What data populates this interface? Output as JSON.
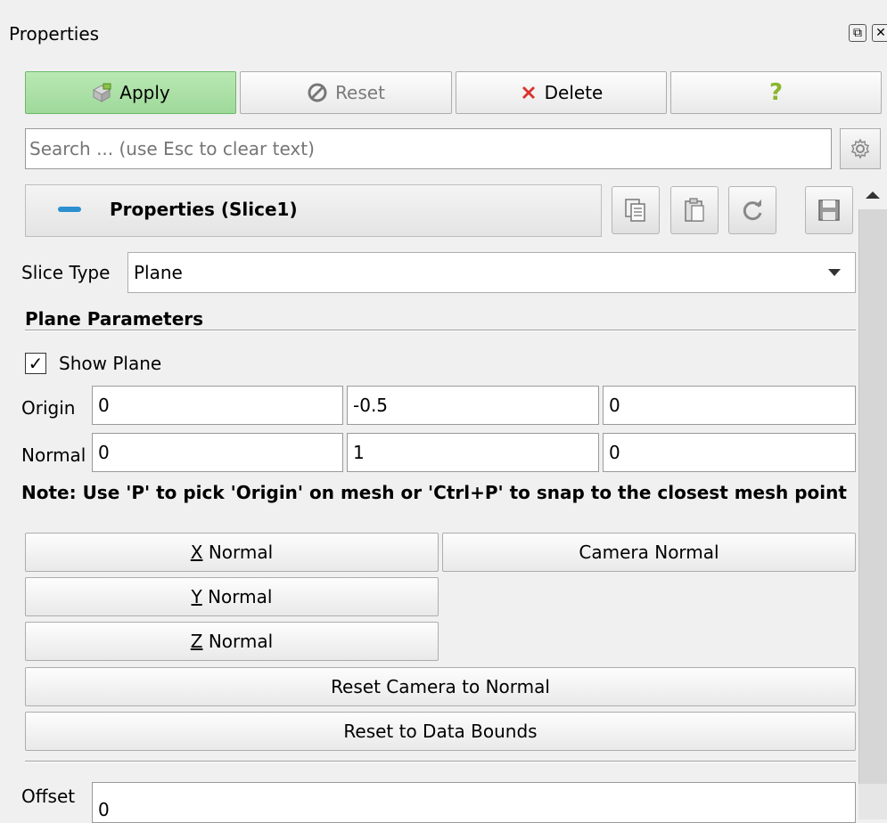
{
  "panel": {
    "title": "Properties",
    "float_icon": "float-icon",
    "close_icon": "close-icon"
  },
  "toolbar": {
    "apply_label": "Apply",
    "reset_label": "Reset",
    "delete_label": "Delete",
    "help_label": "?"
  },
  "search": {
    "placeholder": "Search ... (use Esc to clear text)"
  },
  "section_header": {
    "title": "Properties (Slice1)",
    "buttons": [
      "copy-icon",
      "paste-icon",
      "refresh-icon",
      "save-icon"
    ]
  },
  "slice_type": {
    "label": "Slice Type",
    "value": "Plane"
  },
  "plane_parameters": {
    "title": "Plane Parameters",
    "show_plane_label": "Show Plane",
    "show_plane_checked": true,
    "checkmark": "✓",
    "origin_label": "Origin",
    "origin": [
      "0",
      "-0.5",
      "0"
    ],
    "normal_label": "Normal",
    "normal": [
      "0",
      "1",
      "0"
    ],
    "note": "Note: Use 'P' to pick 'Origin' on mesh or 'Ctrl+P' to snap to the closest mesh point",
    "x_normal_mnemonic": "X",
    "x_normal_rest": " Normal",
    "camera_normal_label": "Camera Normal",
    "y_normal_mnemonic": "Y",
    "y_normal_rest": " Normal",
    "z_normal_mnemonic": "Z",
    "z_normal_rest": " Normal",
    "reset_camera_label": "Reset Camera to Normal",
    "reset_bounds_label": "Reset to Data Bounds"
  },
  "offset": {
    "label": "Offset",
    "value": "0"
  },
  "colors": {
    "apply_bg": "#a8deA3",
    "accent_blue": "#2b8fd0",
    "delete_red": "#d9342b",
    "help_green": "#8ab62e"
  }
}
